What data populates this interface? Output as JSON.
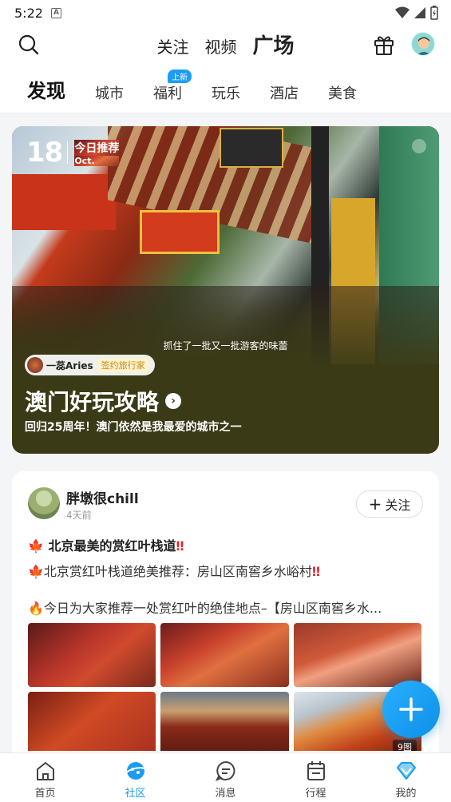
{
  "status": {
    "time": "5:22",
    "notif": "A"
  },
  "header": {
    "main_tabs": [
      {
        "label": "关注"
      },
      {
        "label": "视频"
      },
      {
        "label": "广场"
      }
    ],
    "sub_tabs": [
      {
        "label": "发现"
      },
      {
        "label": "城市"
      },
      {
        "label": "福利",
        "badge": "上新"
      },
      {
        "label": "玩乐"
      },
      {
        "label": "酒店"
      },
      {
        "label": "美食"
      }
    ]
  },
  "hero": {
    "date_num": "18",
    "date_label": "今日推荐",
    "date_month": "Oct.",
    "caption": "抓住了一批又一批游客的味蕾",
    "author_name": "一蕊Aries",
    "author_tag": "签约旅行家",
    "title": "澳门好玩攻略",
    "subtitle": "回归25周年！澳门依然是我最爱的城市之一"
  },
  "post": {
    "author": "胖墩很chill",
    "time": "4天前",
    "follow_label": "关注",
    "title": "北京最美的赏红叶栈道",
    "line2": "北京赏红叶栈道绝美推荐：房山区南窖乡水峪村",
    "line3": "今日为大家推荐一处赏红叶的绝佳地点–【房山区南窖乡水...",
    "image_count": "9图",
    "marks": {
      "leaf": "🍁",
      "warn": "‼",
      "fire": "🔥"
    }
  },
  "bottom_nav": [
    {
      "label": "首页"
    },
    {
      "label": "社区"
    },
    {
      "label": "消息"
    },
    {
      "label": "行程"
    },
    {
      "label": "我的"
    }
  ],
  "colors": {
    "accent": "#1b9cf2",
    "hero_bg": "#3b3a17"
  }
}
